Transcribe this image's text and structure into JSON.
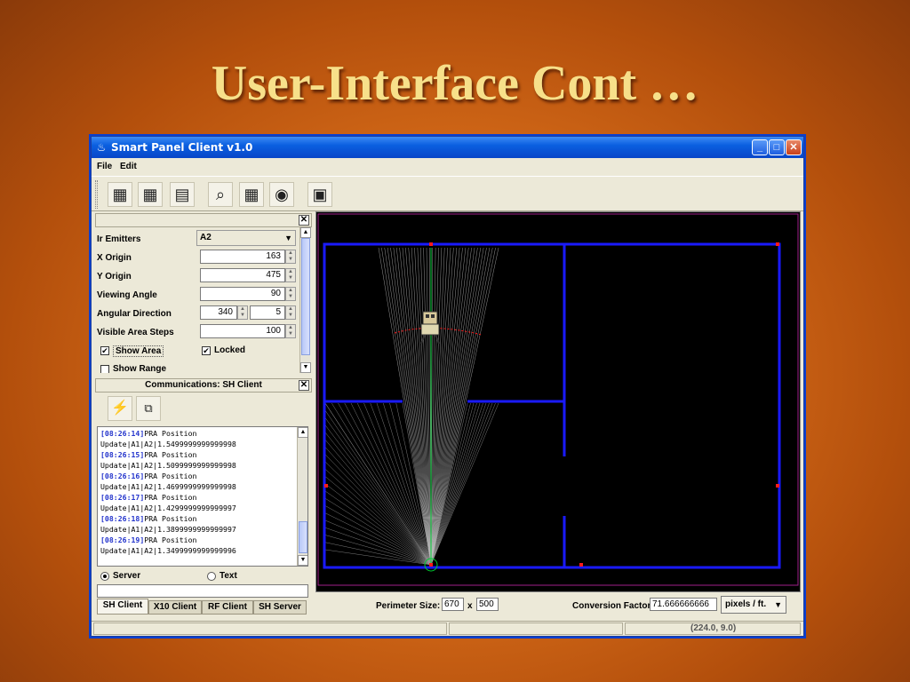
{
  "slide": {
    "title": "User-Interface Cont …"
  },
  "window": {
    "title": "Smart Panel Client v1.0",
    "icon": "app-icon",
    "controls": {
      "minimize": "_",
      "maximize": "□",
      "close": "✕"
    }
  },
  "menu": [
    "File",
    "Edit"
  ],
  "toolbar": {
    "buttons": [
      "add-wall-icon",
      "delete-wall-icon",
      "add-panel-icon",
      "zoom-icon",
      "grid-icon",
      "emitter-icon",
      "network-icon"
    ],
    "glyphs": [
      "▦",
      "▦",
      "▤",
      "⌕",
      "▦",
      "◉",
      "▣"
    ]
  },
  "properties": {
    "close": "✕",
    "ir_emitters": {
      "label": "Ir Emitters",
      "value": "A2"
    },
    "x_origin": {
      "label": "X Origin",
      "value": "163"
    },
    "y_origin": {
      "label": "Y Origin",
      "value": "475"
    },
    "viewing_angle": {
      "label": "Viewing Angle",
      "value": "90"
    },
    "angular_direction": {
      "label": "Angular Direction",
      "value1": "340",
      "value2": "5"
    },
    "visible_area_steps": {
      "label": "Visible Area Steps",
      "value": "100"
    },
    "show_area": {
      "label": "Show Area",
      "checked": true
    },
    "locked": {
      "label": "Locked",
      "checked": true
    },
    "show_range": {
      "label": "Show Range",
      "checked": false
    }
  },
  "communications": {
    "title": "Communications:  SH Client",
    "close": "✕",
    "log": [
      {
        "ts": "[08:26:14]",
        "msg": "PRA Position"
      },
      {
        "ts": "",
        "msg": "Update|A1|A2|1.5499999999999998"
      },
      {
        "ts": "[08:26:15]",
        "msg": "PRA Position"
      },
      {
        "ts": "",
        "msg": "Update|A1|A2|1.5099999999999998"
      },
      {
        "ts": "[08:26:16]",
        "msg": "PRA Position"
      },
      {
        "ts": "",
        "msg": "Update|A1|A2|1.4699999999999998"
      },
      {
        "ts": "[08:26:17]",
        "msg": "PRA Position"
      },
      {
        "ts": "",
        "msg": "Update|A1|A2|1.4299999999999997"
      },
      {
        "ts": "[08:26:18]",
        "msg": "PRA Position"
      },
      {
        "ts": "",
        "msg": "Update|A1|A2|1.3899999999999997"
      },
      {
        "ts": "[08:26:19]",
        "msg": "PRA Position"
      },
      {
        "ts": "",
        "msg": "Update|A1|A2|1.3499999999999996"
      }
    ],
    "mode_server": "Server",
    "mode_text": "Text",
    "selected_mode": "Server",
    "tabs": [
      "SH Client",
      "X10 Client",
      "RF Client",
      "SH Server"
    ],
    "active_tab": "SH Client"
  },
  "bottom": {
    "perimeter_label": "Perimeter Size:",
    "perimeter_w": "670",
    "times": "x",
    "perimeter_h": "500",
    "conversion_label": "Conversion Factor:",
    "conversion_value": "71.666666666",
    "unit": "pixels / ft."
  },
  "status": {
    "coords": "(224.0, 9.0)"
  },
  "colors": {
    "wall": "#1a1aff",
    "beam": "#00cc33",
    "marker": "#ff1a1a",
    "canvas": "#000000"
  }
}
